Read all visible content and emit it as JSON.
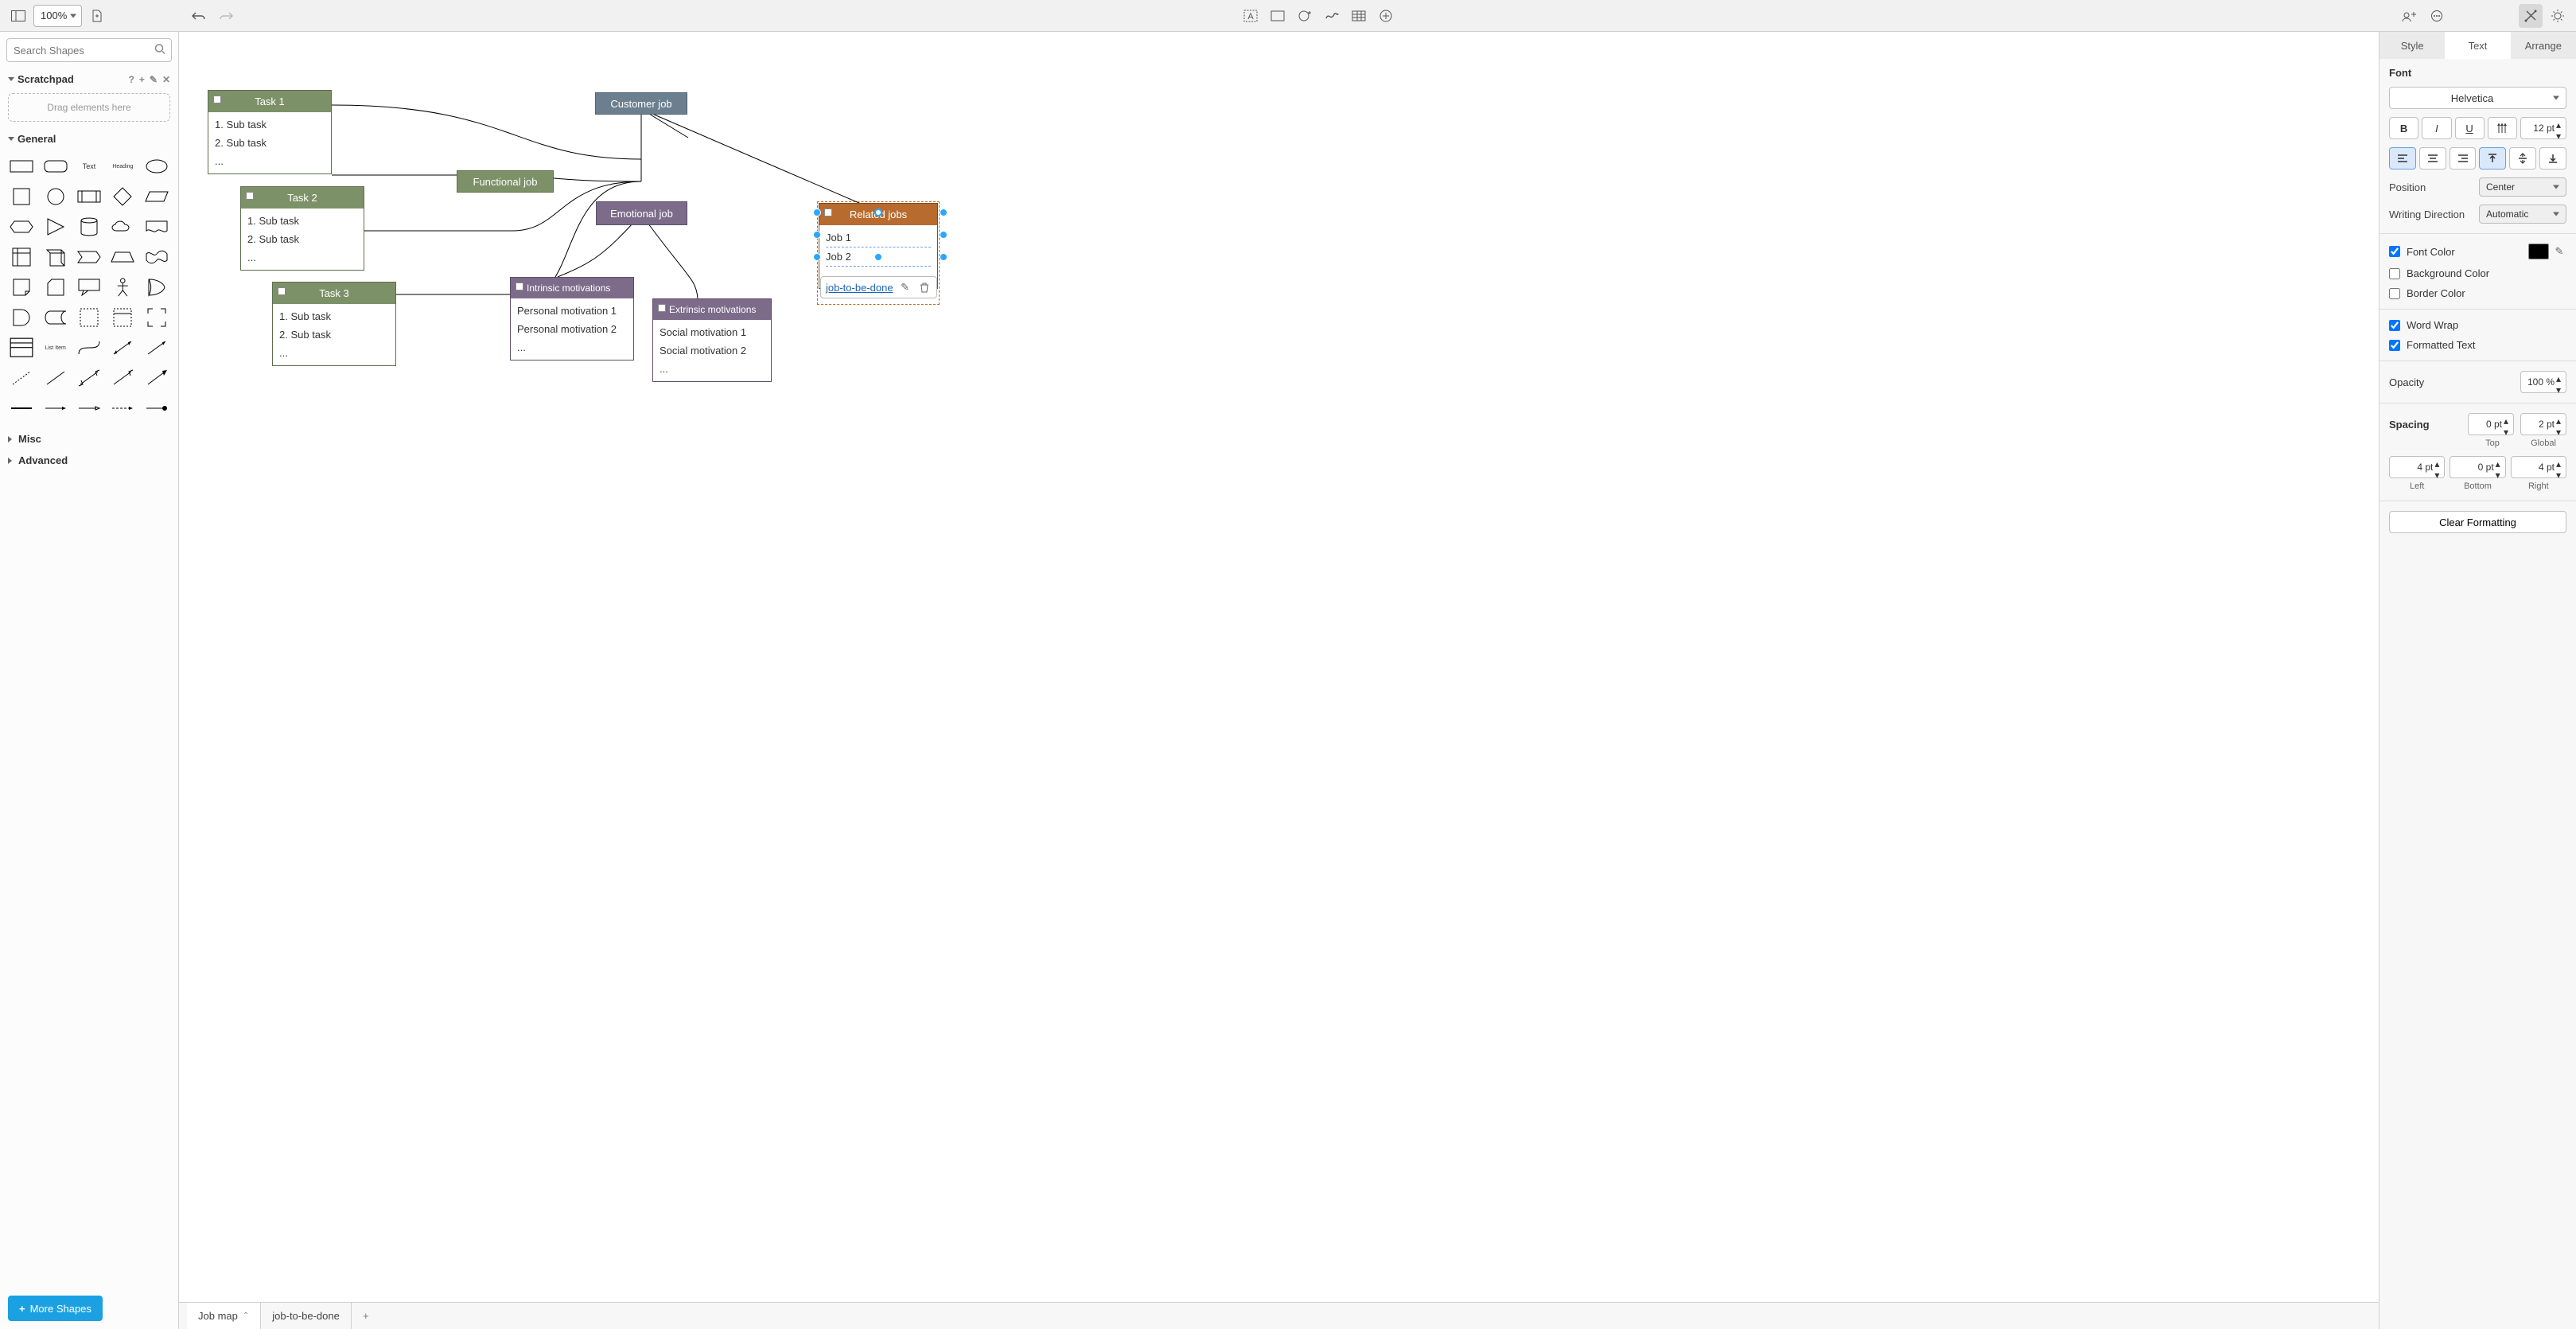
{
  "toolbar": {
    "zoom": "100%"
  },
  "left": {
    "search_placeholder": "Search Shapes",
    "scratchpad": {
      "title": "Scratchpad",
      "dropzone": "Drag elements here"
    },
    "sections": {
      "general": "General",
      "misc": "Misc",
      "advanced": "Advanced"
    },
    "shape_text": "Text",
    "shape_heading": "Heading",
    "shape_listitem": "List Item",
    "more_shapes": "More Shapes"
  },
  "pages": {
    "tab1": "Job map",
    "tab2": "job-to-be-done"
  },
  "right": {
    "tabs": {
      "style": "Style",
      "text": "Text",
      "arrange": "Arrange"
    },
    "font_label": "Font",
    "font_family": "Helvetica",
    "font_size": "12 pt",
    "position_label": "Position",
    "position_value": "Center",
    "writing_label": "Writing Direction",
    "writing_value": "Automatic",
    "font_color_label": "Font Color",
    "bg_color_label": "Background Color",
    "border_color_label": "Border Color",
    "word_wrap_label": "Word Wrap",
    "formatted_text_label": "Formatted Text",
    "opacity_label": "Opacity",
    "opacity_value": "100 %",
    "spacing_label": "Spacing",
    "spacing": {
      "top": "0 pt",
      "global": "2 pt",
      "left": "4 pt",
      "bottom": "0 pt",
      "right": "4 pt"
    },
    "spacing_labels": {
      "top": "Top",
      "global": "Global",
      "left": "Left",
      "bottom": "Bottom",
      "right": "Right"
    },
    "clear_formatting": "Clear Formatting"
  },
  "diagram": {
    "customer_job": "Customer job",
    "functional_job": "Functional job",
    "emotional_job": "Emotional job",
    "related_jobs": {
      "title": "Related jobs",
      "row1": "Job 1",
      "row2": "Job 2",
      "row3": "..."
    },
    "task1": {
      "title": "Task 1",
      "r1": "1. Sub task",
      "r2": "2. Sub task",
      "r3": "..."
    },
    "task2": {
      "title": "Task 2",
      "r1": "1. Sub task",
      "r2": "2. Sub task",
      "r3": "..."
    },
    "task3": {
      "title": "Task 3",
      "r1": "1. Sub task",
      "r2": "2. Sub task",
      "r3": "..."
    },
    "intrinsic": {
      "title": "Intrinsic motivations",
      "r1": "Personal motivation 1",
      "r2": "Personal motivation 2",
      "r3": "..."
    },
    "extrinsic": {
      "title": "Extrinsic motivations",
      "r1": "Social motivation 1",
      "r2": "Social motivation 2",
      "r3": "..."
    },
    "link_text": "job-to-be-done"
  }
}
